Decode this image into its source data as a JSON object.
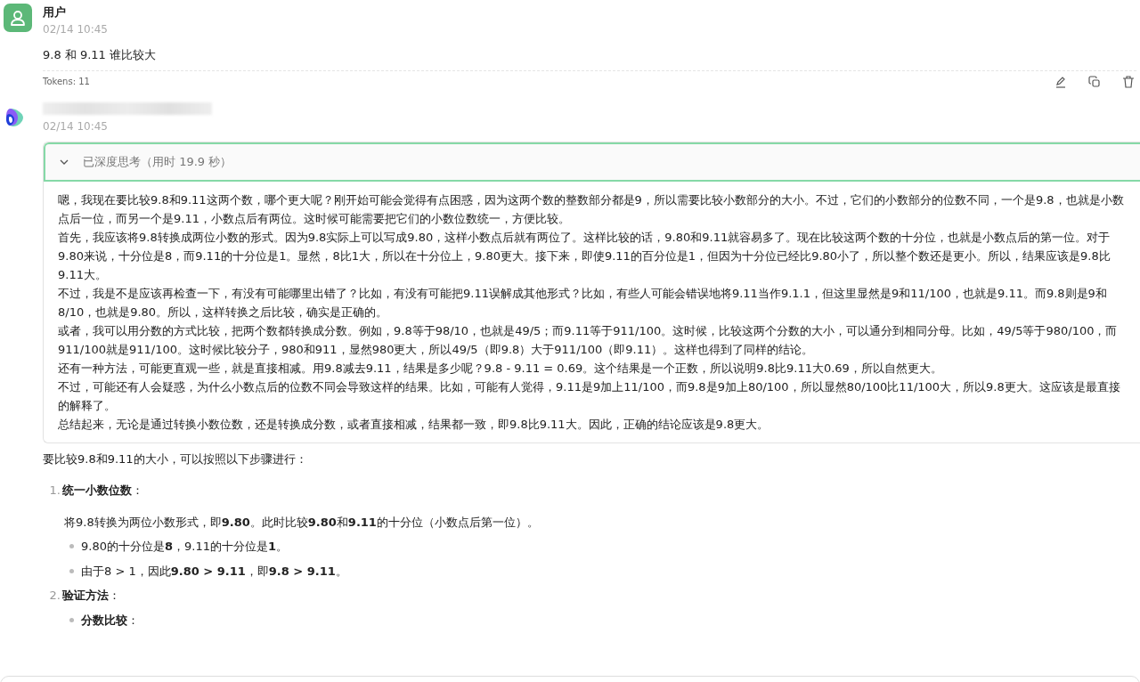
{
  "user_message": {
    "author": "用户",
    "time": "02/14 10:45",
    "text": "9.8 和 9.11 谁比较大",
    "tokens": "Tokens: 11"
  },
  "assistant_message": {
    "time": "02/14 10:45",
    "thinking": {
      "label": "已深度思考（用时 19.9 秒）",
      "expanded": true,
      "paragraphs": [
        "嗯，我现在要比较9.8和9.11这两个数，哪个更大呢？刚开始可能会觉得有点困惑，因为这两个数的整数部分都是9，所以需要比较小数部分的大小。不过，它们的小数部分的位数不同，一个是9.8，也就是小数点后一位，而另一个是9.11，小数点后有两位。这时候可能需要把它们的小数位数统一，方便比较。",
        "首先，我应该将9.8转换成两位小数的形式。因为9.8实际上可以写成9.80，这样小数点后就有两位了。这样比较的话，9.80和9.11就容易多了。现在比较这两个数的十分位，也就是小数点后的第一位。对于9.80来说，十分位是8，而9.11的十分位是1。显然，8比1大，所以在十分位上，9.80更大。接下来，即使9.11的百分位是1，但因为十分位已经比9.80小了，所以整个数还是更小。所以，结果应该是9.8比9.11大。",
        "不过，我是不是应该再检查一下，有没有可能哪里出错了？比如，有没有可能把9.11误解成其他形式？比如，有些人可能会错误地将9.11当作9.1.1，但这里显然是9和11/100，也就是9.11。而9.8则是9和8/10，也就是9.80。所以，这样转换之后比较，确实是正确的。",
        "或者，我可以用分数的方式比较，把两个数都转换成分数。例如，9.8等于98/10，也就是49/5；而9.11等于911/100。这时候，比较这两个分数的大小，可以通分到相同分母。比如，49/5等于980/100，而911/100就是911/100。这时候比较分子，980和911，显然980更大，所以49/5（即9.8）大于911/100（即9.11）。这样也得到了同样的结论。",
        "还有一种方法，可能更直观一些，就是直接相减。用9.8减去9.11，结果是多少呢？9.8 - 9.11 = 0.69。这个结果是一个正数，所以说明9.8比9.11大0.69，所以自然更大。",
        "不过，可能还有人会疑惑，为什么小数点后的位数不同会导致这样的结果。比如，可能有人觉得，9.11是9加上11/100，而9.8是9加上80/100，所以显然80/100比11/100大，所以9.8更大。这应该是最直接的解释了。",
        "总结起来，无论是通过转换小数位数，还是转换成分数，或者直接相减，结果都一致，即9.8比9.11大。因此，正确的结论应该是9.8更大。"
      ]
    },
    "intro": "要比较9.8和9.11的大小，可以按照以下步骤进行：",
    "steps": [
      {
        "number": "1.",
        "title": "**统一小数位数**：",
        "paragraph": "将9.8转换为两位小数形式，即**9.80**。此时比较**9.80**和**9.11**的十分位（小数点后第一位）。",
        "bullets": [
          "9.80的十分位是**8**，9.11的十分位是**1**。",
          "由于8 > 1，因此**9.80 > 9.11**，即**9.8 > 9.11**。"
        ]
      },
      {
        "number": "2.",
        "title": "**验证方法**：",
        "bullets": [
          "**分数比较**："
        ]
      }
    ]
  }
}
